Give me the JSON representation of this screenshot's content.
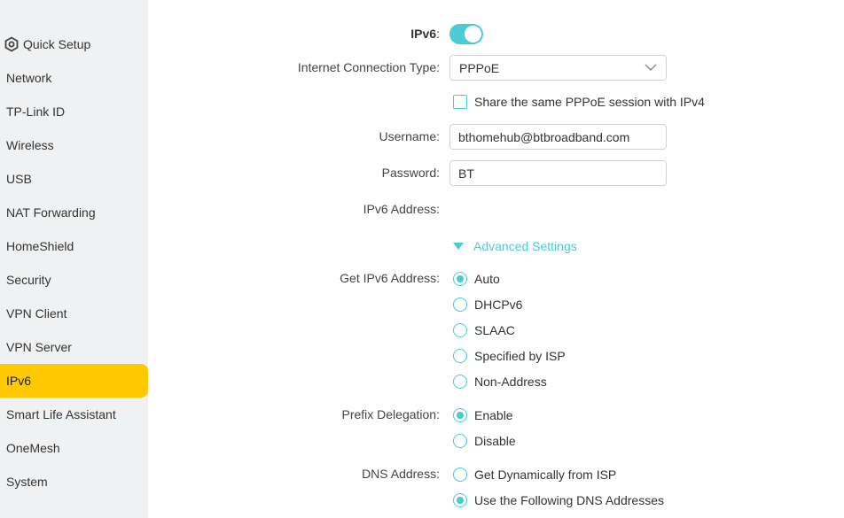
{
  "sidebar": {
    "items": [
      {
        "label": "Quick Setup",
        "icon": "gear-icon"
      },
      {
        "label": "Network"
      },
      {
        "label": "TP-Link ID"
      },
      {
        "label": "Wireless"
      },
      {
        "label": "USB"
      },
      {
        "label": "NAT Forwarding"
      },
      {
        "label": "HomeShield"
      },
      {
        "label": "Security"
      },
      {
        "label": "VPN Client"
      },
      {
        "label": "VPN Server"
      },
      {
        "label": "IPv6",
        "active": true
      },
      {
        "label": "Smart Life Assistant"
      },
      {
        "label": "OneMesh"
      },
      {
        "label": "System"
      }
    ]
  },
  "form": {
    "ipv6_label": "IPv6",
    "ipv6_colon": ":",
    "ipv6_enabled": true,
    "connection_type_label": "Internet Connection Type:",
    "connection_type_value": "PPPoE",
    "share_session_label": "Share the same PPPoE session with IPv4",
    "share_session_checked": false,
    "username_label": "Username:",
    "username_value": "bthomehub@btbroadband.com",
    "password_label": "Password:",
    "password_value": "BT",
    "ipv6_address_label": "IPv6 Address:",
    "advanced_settings_label": "Advanced Settings",
    "get_address_label": "Get IPv6 Address:",
    "get_address_options": [
      "Auto",
      "DHCPv6",
      "SLAAC",
      "Specified by ISP",
      "Non-Address"
    ],
    "get_address_selected": "Auto",
    "prefix_delegation_label": "Prefix Delegation:",
    "prefix_delegation_options": [
      "Enable",
      "Disable"
    ],
    "prefix_delegation_selected": "Enable",
    "dns_address_label": "DNS Address:",
    "dns_address_options": [
      "Get Dynamically from ISP",
      "Use the Following DNS Addresses"
    ],
    "dns_address_selected": "Use the Following DNS Addresses"
  },
  "colors": {
    "accent": "#4acbd6",
    "active_nav": "#ffc800",
    "sidebar_bg": "#f0f1f2"
  }
}
